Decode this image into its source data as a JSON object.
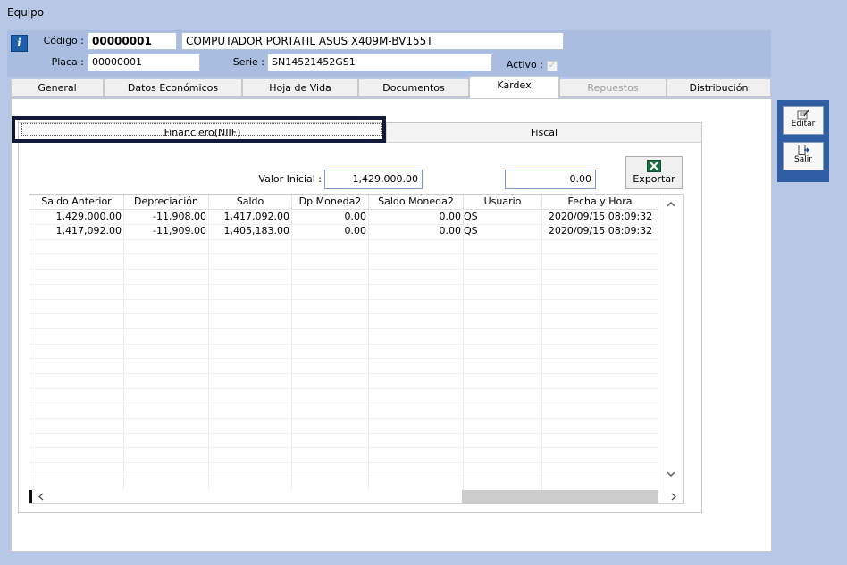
{
  "window": {
    "title": "Equipo"
  },
  "header": {
    "codigo_label": "Código :",
    "codigo_value": "00000001",
    "descripcion_value": "COMPUTADOR PORTATIL ASUS X409M-BV155T",
    "placa_label": "Placa :",
    "placa_value": "00000001",
    "serie_label": "Serie :",
    "serie_value": "SN14521452GS1",
    "activo_label": "Activo :",
    "activo_checked": true
  },
  "tabs": [
    {
      "label": "General",
      "active": false,
      "disabled": false
    },
    {
      "label": "Datos Económicos",
      "active": false,
      "disabled": false
    },
    {
      "label": "Hoja de Vida",
      "active": false,
      "disabled": false
    },
    {
      "label": "Documentos",
      "active": false,
      "disabled": false
    },
    {
      "label": "Kardex",
      "active": true,
      "disabled": false
    },
    {
      "label": "Repuestos",
      "active": false,
      "disabled": true
    },
    {
      "label": "Distribución",
      "active": false,
      "disabled": false
    }
  ],
  "subtabs": [
    {
      "label": "Financiero(NIIF)",
      "active": true
    },
    {
      "label": "Fiscal",
      "active": false
    }
  ],
  "kardex": {
    "valor_inicial_label": "Valor Inicial :",
    "valor_inicial_value": "1,429,000.00",
    "second_value": "0.00",
    "export_label": "Exportar"
  },
  "side_buttons": {
    "editar": "Editar",
    "salir": "Salir"
  },
  "grid": {
    "columns": [
      "Saldo Anterior",
      "Depreciación",
      "Saldo",
      "Dp Moneda2",
      "Saldo Moneda2",
      "Usuario",
      "Fecha y Hora"
    ],
    "rows": [
      [
        "1,429,000.00",
        "-11,908.00",
        "1,417,092.00",
        "0.00",
        "0.00",
        "QS",
        "2020/09/15 08:09:32"
      ],
      [
        "1,417,092.00",
        "-11,909.00",
        "1,405,183.00",
        "0.00",
        "0.00",
        "QS",
        "2020/09/15 08:09:32"
      ]
    ]
  },
  "colors": {
    "frame": "#b7c8e6",
    "header_band": "#a9bde0",
    "side_bar": "#2f5ea4",
    "focus": "#141a3a",
    "excel_green": "#1e7145"
  }
}
